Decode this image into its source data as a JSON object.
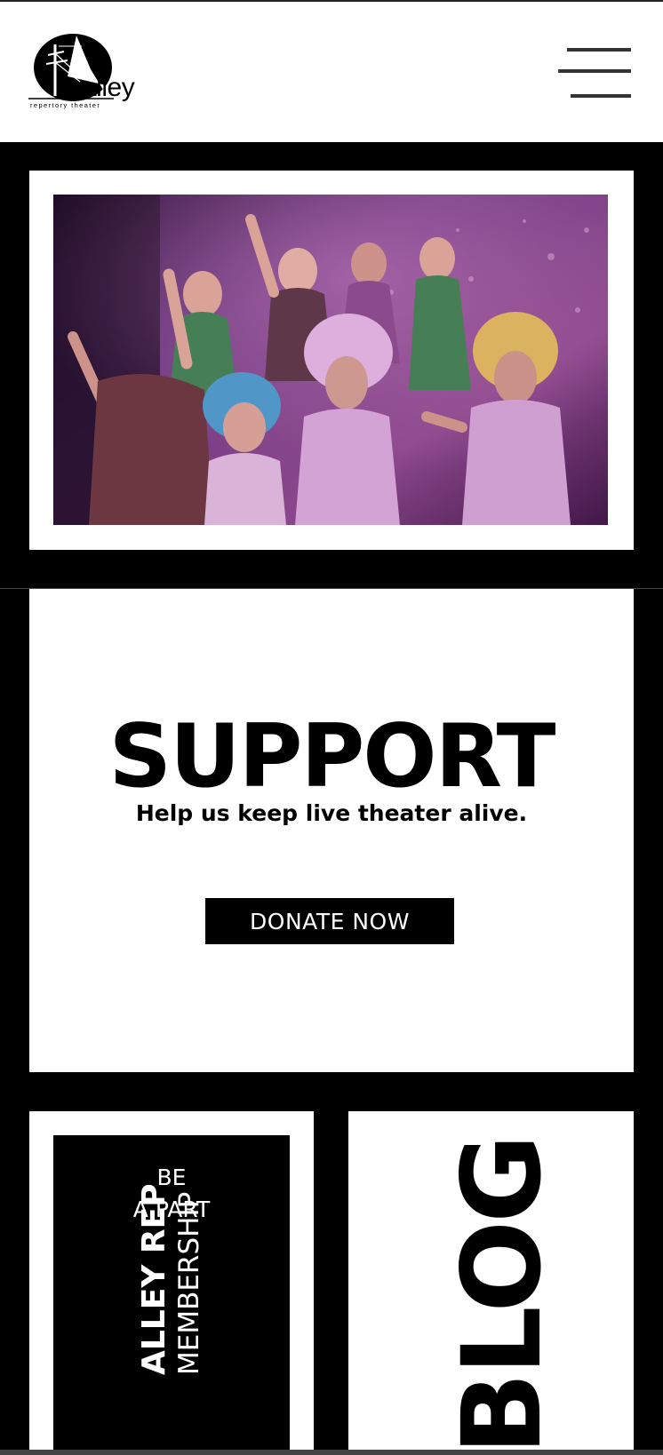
{
  "header": {
    "logo_word": "alley",
    "logo_tagline": "repertory theater",
    "menu_icon": "hamburger-menu-icon"
  },
  "hero": {
    "image_icon": "theater-performance-photo"
  },
  "support": {
    "title": "SUPPORT",
    "subtitle": "Help us keep live theater alive.",
    "donate_label": "DONATE NOW"
  },
  "membership": {
    "line1": "BE",
    "line2": "A PART",
    "vertical_line1": "ALLEY REP",
    "vertical_line2": "MEMBERSHIP"
  },
  "blog": {
    "label": "BLOG"
  },
  "colors": {
    "background": "#000000",
    "panel": "#ffffff",
    "text": "#000000"
  }
}
